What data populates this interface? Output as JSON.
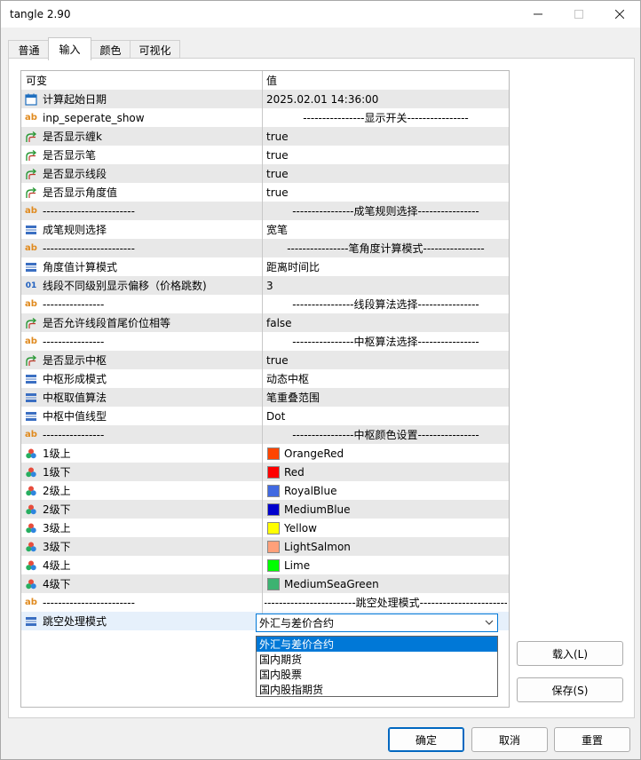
{
  "window": {
    "title": "tangle 2.90"
  },
  "tabs": [
    "普通",
    "输入",
    "颜色",
    "可视化"
  ],
  "grid": {
    "headers": [
      "可变",
      "值"
    ],
    "rows": [
      {
        "icon": "calendar-icon",
        "name": "计算起始日期",
        "value": "2025.02.01 14:36:00"
      },
      {
        "icon": "string-icon",
        "name": "inp_seperate_show",
        "value": "----------------显示开关----------------",
        "center": true
      },
      {
        "icon": "bool-icon",
        "name": "是否显示缠k",
        "value": "true"
      },
      {
        "icon": "bool-icon",
        "name": "是否显示笔",
        "value": "true"
      },
      {
        "icon": "bool-icon",
        "name": "是否显示线段",
        "value": "true"
      },
      {
        "icon": "bool-icon",
        "name": "是否显示角度值",
        "value": "true"
      },
      {
        "icon": "string-icon",
        "name": "------------------------",
        "value": "----------------成笔规则选择----------------",
        "center": true
      },
      {
        "icon": "enum-icon",
        "name": "成笔规则选择",
        "value": "宽笔"
      },
      {
        "icon": "string-icon",
        "name": "------------------------",
        "value": "----------------笔角度计算模式----------------",
        "center": true
      },
      {
        "icon": "enum-icon",
        "name": "角度值计算模式",
        "value": "距离时间比"
      },
      {
        "icon": "int-icon",
        "name": "线段不同级别显示偏移（价格跳数)",
        "value": "3"
      },
      {
        "icon": "string-icon",
        "name": "----------------",
        "value": "----------------线段算法选择----------------",
        "center": true
      },
      {
        "icon": "bool-icon",
        "name": "是否允许线段首尾价位相等",
        "value": "false"
      },
      {
        "icon": "string-icon",
        "name": "----------------",
        "value": "----------------中枢算法选择----------------",
        "center": true
      },
      {
        "icon": "bool-icon",
        "name": "是否显示中枢",
        "value": "true"
      },
      {
        "icon": "enum-icon",
        "name": "中枢形成模式",
        "value": "动态中枢"
      },
      {
        "icon": "enum-icon",
        "name": "中枢取值算法",
        "value": "笔重叠范围"
      },
      {
        "icon": "enum-icon",
        "name": "中枢中值线型",
        "value": "Dot"
      },
      {
        "icon": "string-icon",
        "name": "----------------",
        "value": "----------------中枢颜色设置----------------",
        "center": true
      },
      {
        "icon": "color-icon",
        "name": "1级上",
        "value": "OrangeRed",
        "swatch": "#ff4500"
      },
      {
        "icon": "color-icon",
        "name": "1级下",
        "value": "Red",
        "swatch": "#ff0000"
      },
      {
        "icon": "color-icon",
        "name": "2级上",
        "value": "RoyalBlue",
        "swatch": "#4169e1"
      },
      {
        "icon": "color-icon",
        "name": "2级下",
        "value": "MediumBlue",
        "swatch": "#0000cd"
      },
      {
        "icon": "color-icon",
        "name": "3级上",
        "value": "Yellow",
        "swatch": "#ffff00"
      },
      {
        "icon": "color-icon",
        "name": "3级下",
        "value": "LightSalmon",
        "swatch": "#ffa07a"
      },
      {
        "icon": "color-icon",
        "name": "4级上",
        "value": "Lime",
        "swatch": "#00ff00"
      },
      {
        "icon": "color-icon",
        "name": "4级下",
        "value": "MediumSeaGreen",
        "swatch": "#3cb371"
      },
      {
        "icon": "string-icon",
        "name": "------------------------",
        "value": "------------------------跳空处理模式-----------------------",
        "center": true
      },
      {
        "icon": "enum-icon",
        "name": "跳空处理模式",
        "value": "",
        "selected": true
      }
    ]
  },
  "combo": {
    "value": "外汇与差价合约",
    "options": [
      "外汇与差价合约",
      "国内期货",
      "国内股票",
      "国内股指期货"
    ],
    "highlighted_index": 0
  },
  "side_buttons": {
    "load": "载入(L)",
    "save": "保存(S)"
  },
  "footer_buttons": {
    "ok": "确定",
    "cancel": "取消",
    "reset": "重置"
  }
}
